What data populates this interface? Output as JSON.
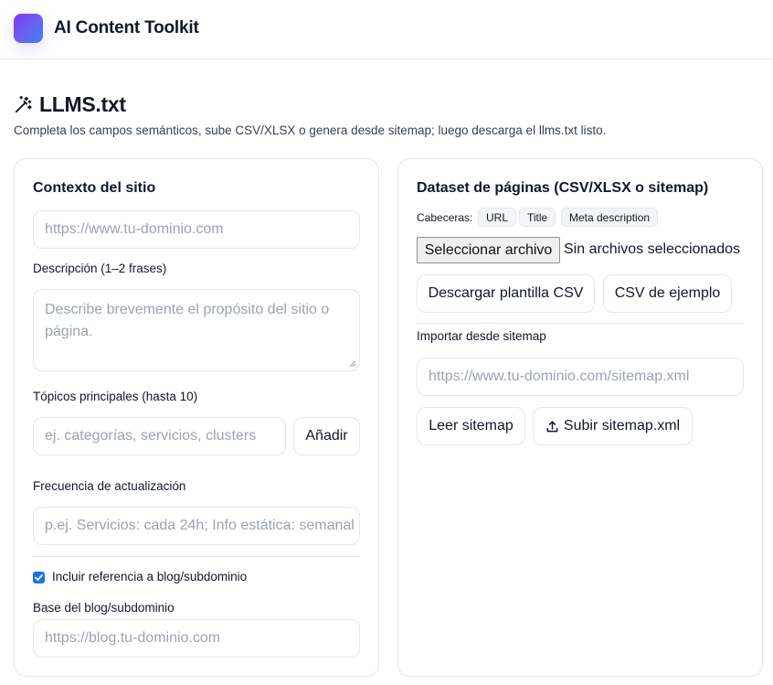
{
  "app": {
    "title": "AI Content Toolkit"
  },
  "page": {
    "title": "LLMS.txt",
    "subtitle": "Completa los campos semánticos, sube CSV/XLSX o genera desde sitemap; luego descarga el llms.txt listo."
  },
  "site_context": {
    "title": "Contexto del sitio",
    "url_placeholder": "https://www.tu-dominio.com",
    "description_label": "Descripción (1–2 frases)",
    "description_placeholder": "Describe brevemente el propósito del sitio o página.",
    "topics_label": "Tópicos principales (hasta 10)",
    "topics_placeholder": "ej. categorías, servicios, clusters",
    "add_button": "Añadir",
    "frequency_label": "Frecuencia de actualización",
    "frequency_placeholder": "p.ej. Servicios: cada 24h; Info estática: semanal",
    "include_blog_label": "Incluir referencia a blog/subdominio",
    "include_blog_checked": true,
    "blog_base_label": "Base del blog/subdominio",
    "blog_base_placeholder": "https://blog.tu-dominio.com"
  },
  "dataset": {
    "title": "Dataset de páginas (CSV/XLSX o sitemap)",
    "headers_label": "Cabeceras:",
    "headers": [
      "URL",
      "Title",
      "Meta description"
    ],
    "select_file_button": "Seleccionar archivo",
    "no_file_text": "Sin archivos seleccionados",
    "download_template_button": "Descargar plantilla CSV",
    "sample_csv_button": "CSV de ejemplo",
    "sitemap_label": "Importar desde sitemap",
    "sitemap_placeholder": "https://www.tu-dominio.com/sitemap.xml",
    "read_sitemap_button": "Leer sitemap",
    "upload_sitemap_button": "Subir sitemap.xml"
  },
  "colors": {
    "accent": "#7c3aed",
    "accent_secondary": "#3b82f6",
    "checkbox": "#1a73e8",
    "border": "#e5e7eb",
    "placeholder": "#9ca3af"
  },
  "icons": {
    "title_icon": "magic-wand-icon",
    "upload_icon": "upload-icon"
  }
}
